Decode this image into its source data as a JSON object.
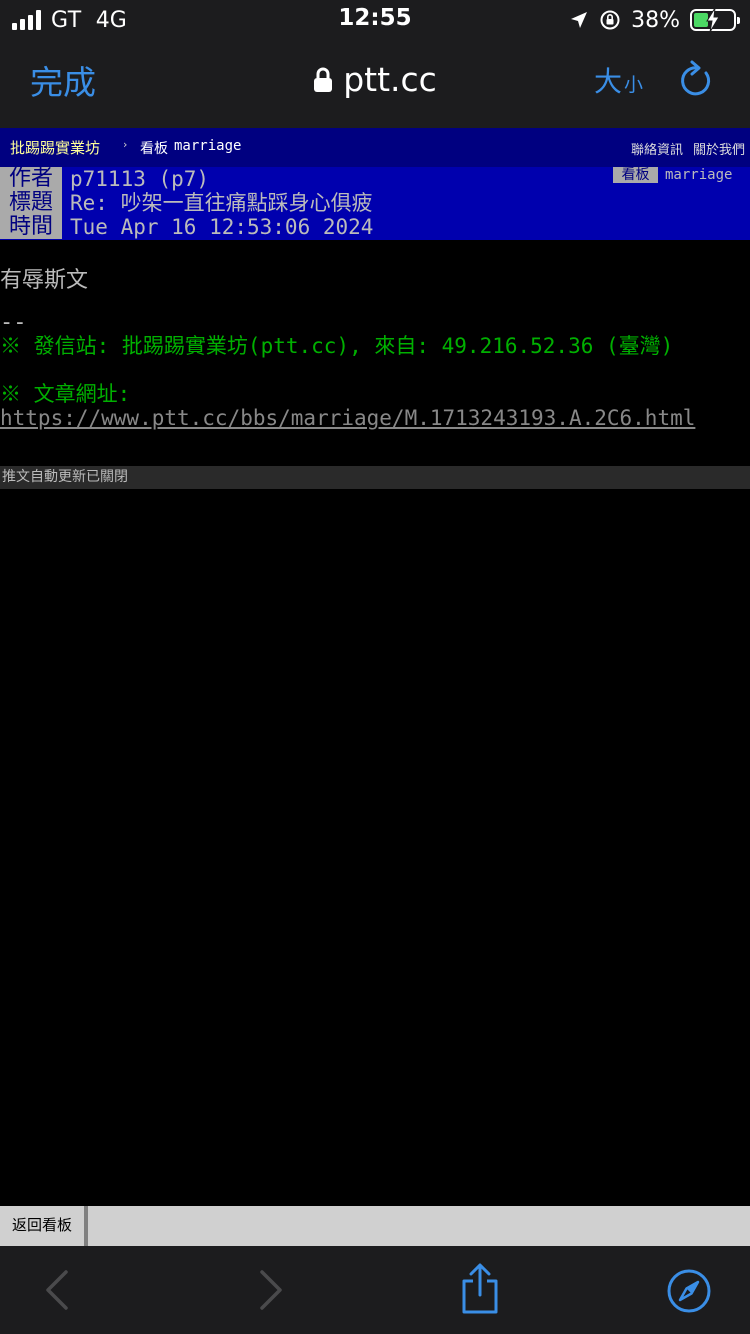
{
  "status_bar": {
    "carrier": "GT",
    "network": "4G",
    "time": "12:55",
    "battery_percent": "38%",
    "battery_level": 0.38,
    "icons": [
      "signal-icon",
      "location-icon",
      "orientation-lock-icon",
      "battery-charging-icon"
    ]
  },
  "nav": {
    "done_label": "完成",
    "url": "ptt.cc",
    "text_size_big": "大",
    "text_size_small": "小"
  },
  "board_bar": {
    "site_name": "批踢踢實業坊",
    "separator": "›",
    "board_label": "看板",
    "board_name": "marriage",
    "contact": "聯絡資訊",
    "about": "關於我們"
  },
  "meta": {
    "author_label": "作者",
    "author": "p71113 (p7)",
    "title_label": "標題",
    "title": "Re: 吵架一直往痛點踩身心俱疲",
    "time_label": "時間",
    "time": "Tue Apr 16 12:53:06 2024",
    "board_label": "看板",
    "board": "marriage"
  },
  "content": {
    "body": "有辱斯文",
    "separator": "--",
    "footer_site": "※ 發信站: 批踢踢實業坊(ptt.cc), 來自: 49.216.52.36 (臺灣)",
    "footer_url_label": "※ 文章網址:",
    "article_url": "https://www.ptt.cc/bbs/marriage/M.1713243193.A.2C6.html"
  },
  "push_status": "推文自動更新已關閉",
  "bottom_bar": {
    "back_label": "返回看板"
  },
  "colors": {
    "accent": "#3a8ee6",
    "board_bar": "#000080",
    "meta_bg": "#0000ae",
    "green": "#00b000"
  }
}
